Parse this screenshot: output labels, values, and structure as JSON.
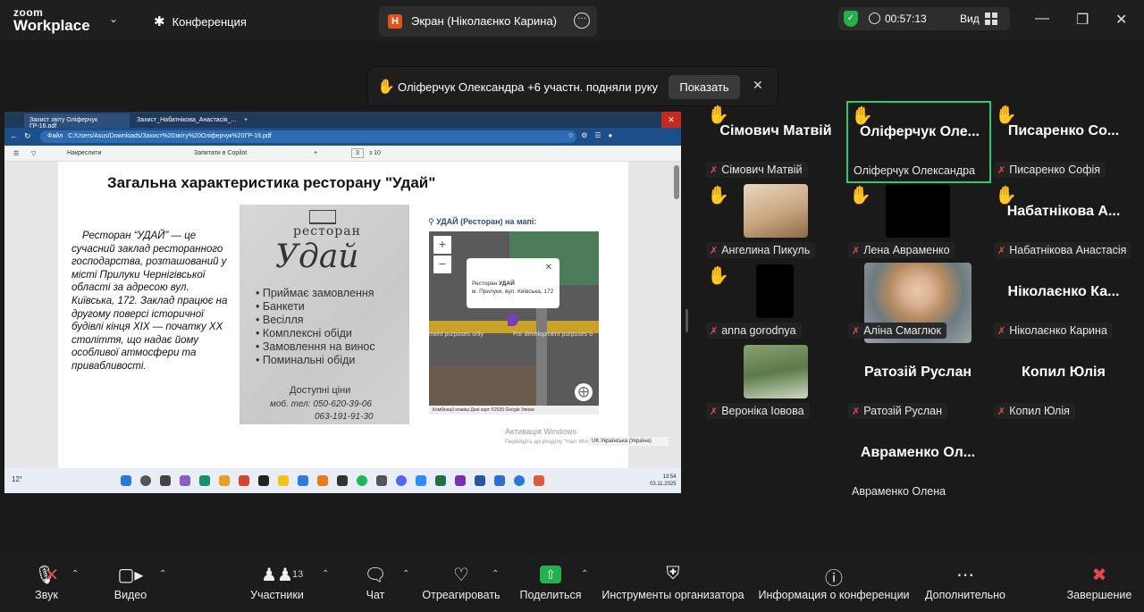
{
  "topbar": {
    "logo_line1": "zoom",
    "logo_line2": "Workplace",
    "conference_label": "Конференция",
    "screen_tab_initial": "Н",
    "screen_tab_label": "Экран (Ніколаєнко Карина)",
    "timer": "00:57:13",
    "view_label": "Вид"
  },
  "banner": {
    "text": "Оліферчук Олександра +6 участн. подняли руку",
    "show_button": "Показать"
  },
  "shared_screen": {
    "tab1": "Захист звіту Оліферчук ГР-16.pdf",
    "tab2": "Захист_Набатнікова_Анастасія_...",
    "file_label": "Файл",
    "url": "C:/Users/Asus/Downloads/Захист%20звіту%20Оліферчук%20ГР-16.pdf",
    "draw_label": "Накреслити",
    "copilot_label": "Запитати в Copilot",
    "page_num": "3",
    "page_total": "з 10",
    "title": "Загальна характеристика ресторану \"Удай\"",
    "body": "Ресторан “УДАЙ” — це сучасний заклад ресторанного господарства, розташований у місті Прилуки Чернігівської області за адресою вул. Київська, 172. Заклад працює на другому поверсі історичної будівлі кінця XIX — початку XX століття, що надає йому особливої атмосфери та привабливості.",
    "photo": {
      "restaurant_word": "ресторан",
      "name_script": "Удай",
      "services": [
        "Приймає замовлення",
        "Банкети",
        "Весілля",
        "Комплексні обіди",
        "Замовлення на винос",
        "Поминальні обіди"
      ],
      "delivery": "Доступні ціни",
      "phone1": "моб. тел: 050-620-39-06",
      "phone2": "063-191-91-30"
    },
    "map": {
      "label": "УДАЙ (Ресторан) на мапі:",
      "popup_line1_pre": "Ресторан ",
      "popup_line1_bold": "УДАЙ",
      "popup_line2": "м. Прилуки, вул. Київська, 172",
      "dev_left": "ment purposes only",
      "dev_right": "For development purposes o",
      "street": "вулиця Возз'єднання",
      "footer": "Комбінації клавіш   Дані карт ©2025 Google   Умови"
    },
    "activation_title": "Активація Windows",
    "activation_sub": "Перейдіть до розділу \"Нал Windows.",
    "lang": "UK Українська (Україна)",
    "weather": "12°",
    "time": "13:54",
    "date": "03.11.2025"
  },
  "participants": [
    {
      "name": "Сімович Матвій",
      "label": "Сімович Матвій",
      "hand": true
    },
    {
      "name": "Оліферчук Оле...",
      "label": "Оліферчук Олександра",
      "hand": true
    },
    {
      "name": "Писаренко Со...",
      "label": "Писаренко Софія",
      "hand": true
    },
    {
      "name": "",
      "label": "Ангелина Пикуль",
      "hand": true
    },
    {
      "name": "",
      "label": "Лена Авраменко",
      "hand": true
    },
    {
      "name": "Набатнікова А...",
      "label": "Набатнікова Анастасія",
      "hand": true
    },
    {
      "name": "",
      "label": "anna gorodnya",
      "hand": true
    },
    {
      "name": "",
      "label": "Аліна Смаглюк",
      "hand": false
    },
    {
      "name": "Ніколаєнко Ка...",
      "label": "Ніколаєнко Карина",
      "hand": false
    },
    {
      "name": "",
      "label": "Вероніка Іовова",
      "hand": false
    },
    {
      "name": "Ратозій Руслан",
      "label": "Ратозій Руслан",
      "hand": false
    },
    {
      "name": "Копил Юлія",
      "label": "Копил Юлія",
      "hand": false
    },
    {
      "name": "Авраменко Ол...",
      "label": "Авраменко Олена",
      "hand": false
    }
  ],
  "toolbar": {
    "audio": "Звук",
    "video": "Видео",
    "participants": "Участники",
    "participants_count": "13",
    "chat": "Чат",
    "react": "Отреагировать",
    "share": "Поделиться",
    "host_tools": "Инструменты организатора",
    "meeting_info": "Информация о конференции",
    "more": "Дополнительно",
    "end": "Завершение"
  },
  "colors": {
    "accent_green": "#2ecc71",
    "share_green": "#22b14c",
    "muted_red": "#e5484d",
    "end_red": "#e5484d"
  }
}
